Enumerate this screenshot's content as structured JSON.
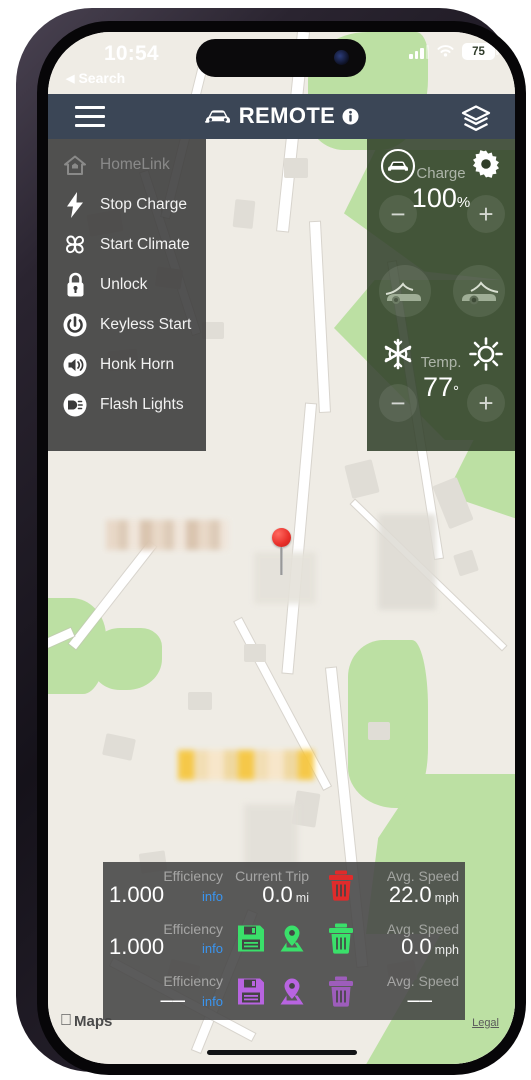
{
  "status_bar": {
    "time": "10:54",
    "back_label": "Search",
    "back_icon": "triangle-left-icon",
    "signal_icon": "cellular-signal-icon",
    "wifi_icon": "wifi-icon",
    "battery_level": "75"
  },
  "nav_bar": {
    "menu_icon": "hamburger-menu-icon",
    "car_icon": "car-icon",
    "title": "REMOTE",
    "info_icon": "info-icon",
    "layers_icon": "map-layers-icon",
    "background_color": "#3b4656"
  },
  "sidebar": {
    "items": [
      {
        "label": "HomeLink",
        "icon": "home-icon",
        "disabled": true
      },
      {
        "label": "Stop Charge",
        "icon": "lightning-bolt-icon",
        "disabled": false
      },
      {
        "label": "Start Climate",
        "icon": "fan-icon",
        "disabled": false
      },
      {
        "label": "Unlock",
        "icon": "lock-icon",
        "disabled": false
      },
      {
        "label": "Keyless Start",
        "icon": "power-icon",
        "disabled": false
      },
      {
        "label": "Honk Horn",
        "icon": "speaker-icon",
        "disabled": false
      },
      {
        "label": "Flash Lights",
        "icon": "headlight-icon",
        "disabled": false
      }
    ]
  },
  "right_panel": {
    "car_status_icon": "car-circle-icon",
    "settings_icon": "gear-icon",
    "charge_label": "Charge",
    "charge_value": "100",
    "charge_unit": "%",
    "charge_minus": "−",
    "charge_plus": "+",
    "frunk_icon": "frunk-open-icon",
    "trunk_icon": "trunk-open-icon",
    "cool_icon": "snowflake-icon",
    "heat_icon": "sun-icon",
    "temp_label": "Temp.",
    "temp_value": "77",
    "temp_unit": "°",
    "temp_minus": "−",
    "temp_plus": "+",
    "background_color": "#2f3e28"
  },
  "map": {
    "pin_icon": "map-pin-icon",
    "attribution": "Maps",
    "apple_logo_icon": "apple-logo-icon",
    "legal_link": "Legal",
    "base_color": "#efece5",
    "park_color": "#bce0a3",
    "road_color": "#ffffff"
  },
  "data_panel": {
    "rows": [
      {
        "efficiency_label": "Efficiency",
        "efficiency_value": "1.000",
        "info_label": "info",
        "mid_label": "Current Trip",
        "mid_value": "0.0",
        "mid_unit": "mi",
        "save_icon": null,
        "location_icon": null,
        "trash_icon": "trash-icon",
        "trash_color": "#e02b2b",
        "speed_label": "Avg. Speed",
        "speed_value": "22.0",
        "speed_unit": "mph"
      },
      {
        "efficiency_label": "Efficiency",
        "efficiency_value": "1.000",
        "info_label": "info",
        "mid_label": null,
        "mid_value": null,
        "mid_unit": null,
        "save_icon": "save-floppy-icon",
        "location_icon": "location-pin-icon",
        "trash_icon": "trash-icon",
        "trash_color": "#3ae06a",
        "speed_label": "Avg. Speed",
        "speed_value": "0.0",
        "speed_unit": "mph"
      },
      {
        "efficiency_label": "Efficiency",
        "efficiency_value": "––",
        "info_label": "info",
        "mid_label": null,
        "mid_value": null,
        "mid_unit": null,
        "save_icon": "save-floppy-icon",
        "location_icon": "location-pin-icon",
        "trash_icon": "trash-icon",
        "trash_color": "#b864e0",
        "speed_label": "Avg. Speed",
        "speed_value": "––",
        "speed_unit": ""
      }
    ],
    "row_colors": [
      "#e02b2b",
      "#3ae06a",
      "#b864e0"
    ],
    "info_link_color": "#3a95f0"
  }
}
